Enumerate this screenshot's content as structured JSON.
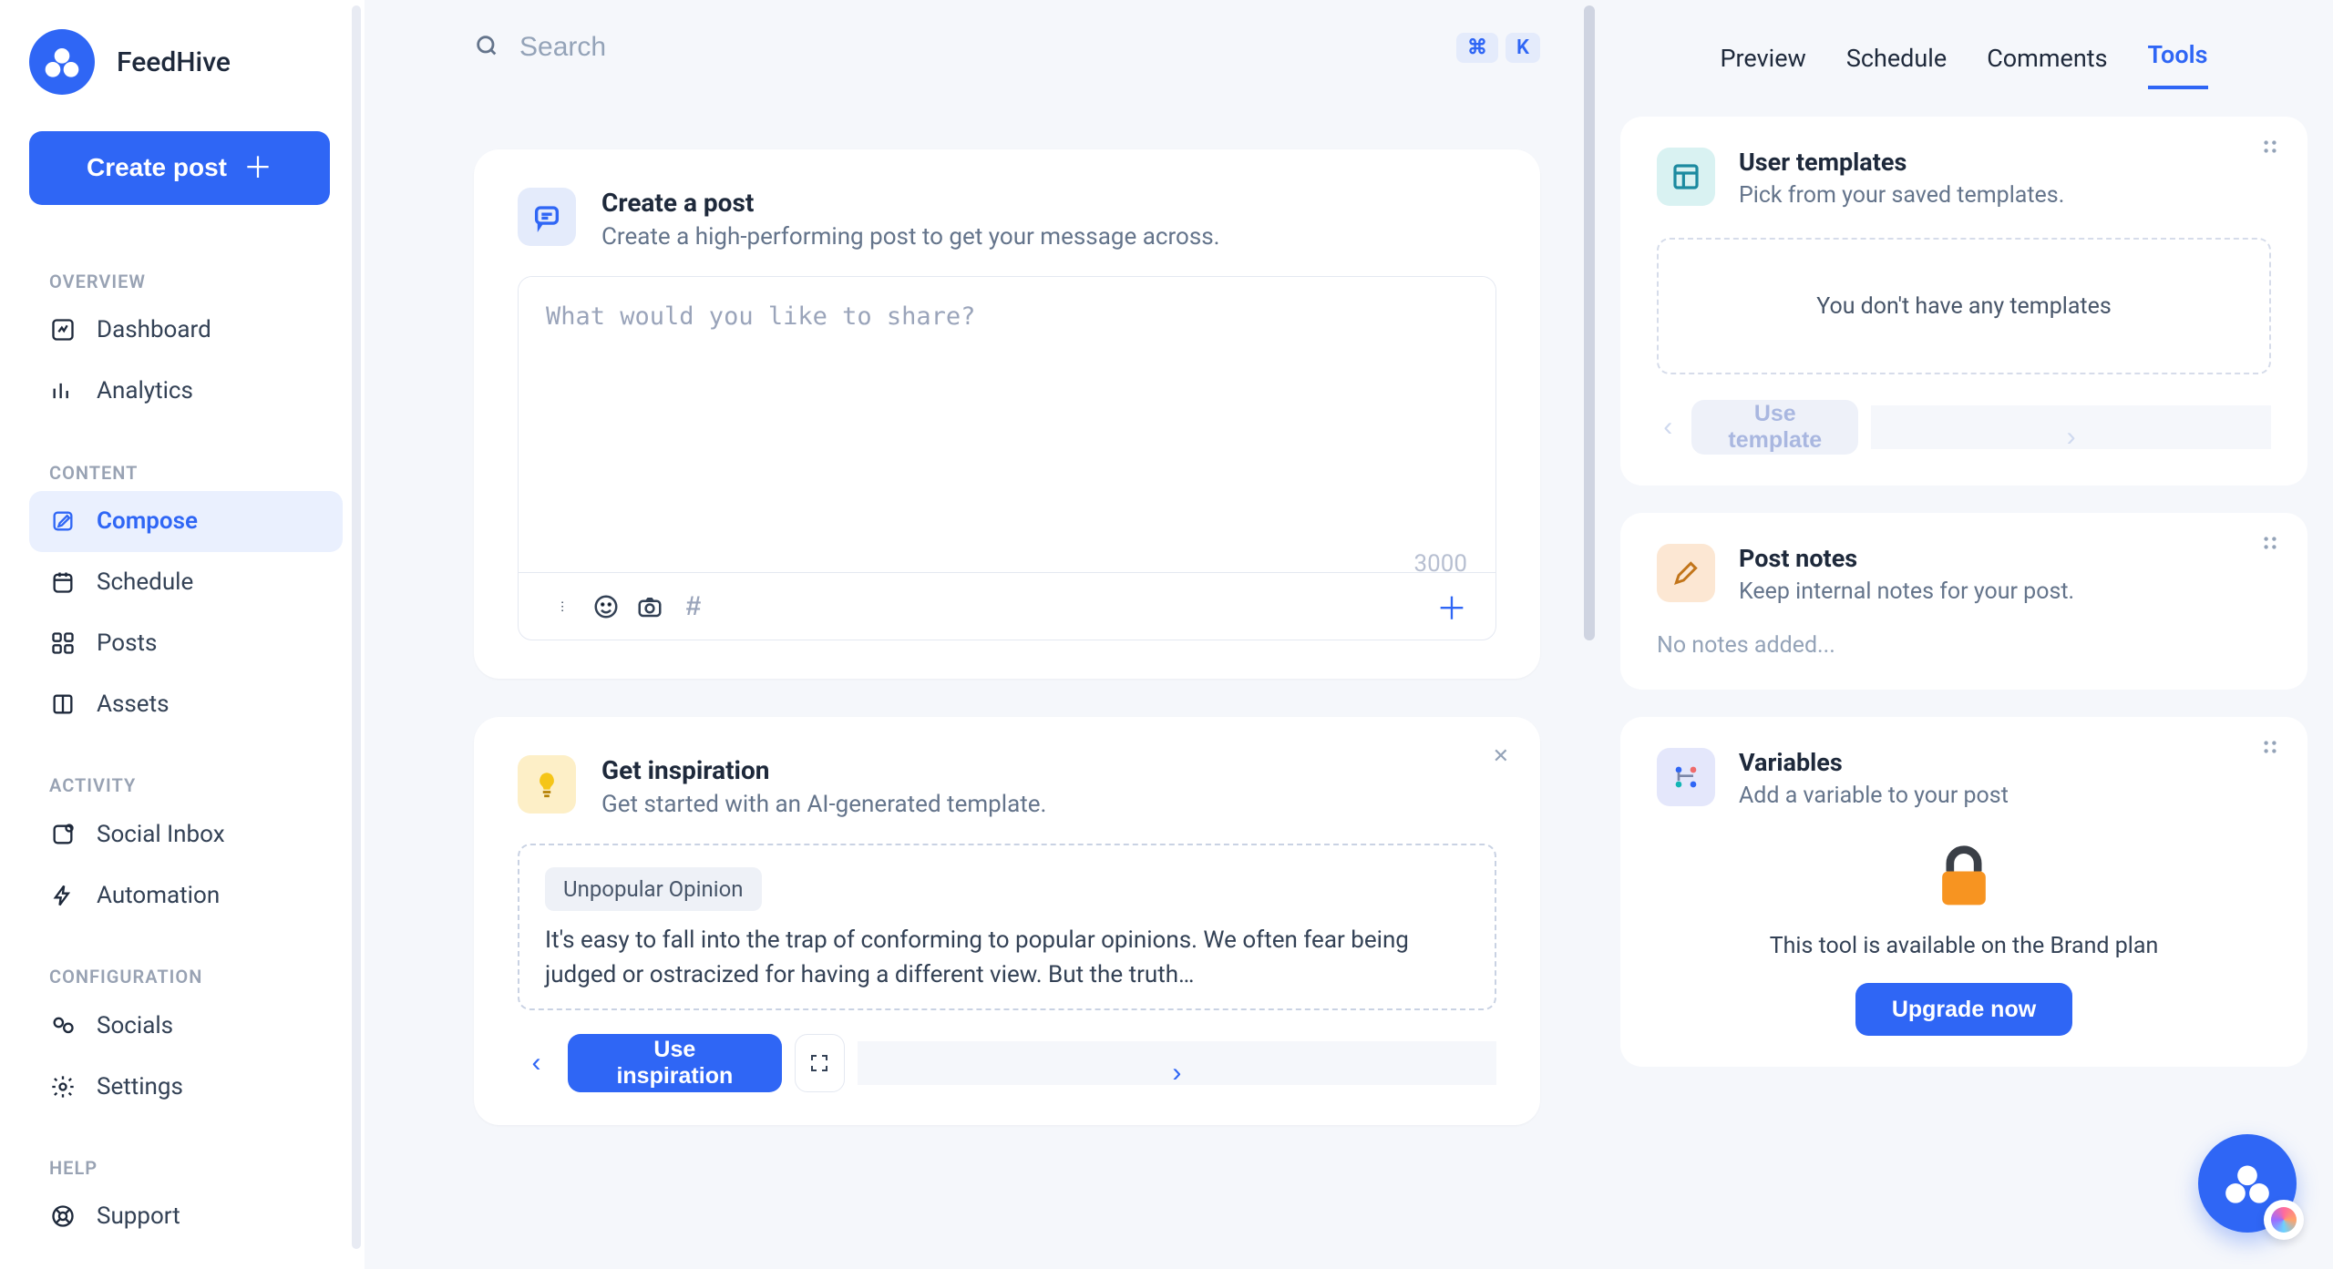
{
  "brand": {
    "name": "FeedHive"
  },
  "create_post_label": "Create post",
  "sidebar": {
    "sections": [
      {
        "label": "OVERVIEW",
        "items": [
          {
            "id": "dashboard",
            "label": "Dashboard"
          },
          {
            "id": "analytics",
            "label": "Analytics"
          }
        ]
      },
      {
        "label": "CONTENT",
        "items": [
          {
            "id": "compose",
            "label": "Compose",
            "active": true
          },
          {
            "id": "schedule",
            "label": "Schedule"
          },
          {
            "id": "posts",
            "label": "Posts"
          },
          {
            "id": "assets",
            "label": "Assets"
          }
        ]
      },
      {
        "label": "ACTIVITY",
        "items": [
          {
            "id": "social-inbox",
            "label": "Social Inbox"
          },
          {
            "id": "automation",
            "label": "Automation"
          }
        ]
      },
      {
        "label": "CONFIGURATION",
        "items": [
          {
            "id": "socials",
            "label": "Socials"
          },
          {
            "id": "settings",
            "label": "Settings"
          }
        ]
      },
      {
        "label": "HELP",
        "items": [
          {
            "id": "support",
            "label": "Support"
          }
        ]
      }
    ]
  },
  "search": {
    "placeholder": "Search",
    "kbd1": "⌘",
    "kbd2": "K"
  },
  "compose": {
    "title": "Create a post",
    "subtitle": "Create a high-performing post to get your message across.",
    "placeholder": "What would you like to share?",
    "char_limit": "3000"
  },
  "toolbar_icons": {
    "more": "more-vertical-icon",
    "emoji": "emoji-icon",
    "camera": "camera-icon",
    "hashtag": "hashtag-icon",
    "add": "plus-icon"
  },
  "inspiration": {
    "title": "Get inspiration",
    "subtitle": "Get started with an AI-generated template.",
    "tag": "Unpopular Opinion",
    "text": "It's easy to fall into the trap of conforming to popular opinions. We often fear being judged or ostracized for having a different view. But the truth…",
    "use_label": "Use inspiration"
  },
  "right_tabs": [
    "Preview",
    "Schedule",
    "Comments",
    "Tools"
  ],
  "right_active_tab": "Tools",
  "user_templates": {
    "title": "User templates",
    "subtitle": "Pick from your saved templates.",
    "empty": "You don't have any templates",
    "use_label": "Use template"
  },
  "post_notes": {
    "title": "Post notes",
    "subtitle": "Keep internal notes for your post.",
    "empty": "No notes added..."
  },
  "variables": {
    "title": "Variables",
    "subtitle": "Add a variable to your post",
    "locked_text": "This tool is available on the Brand plan",
    "upgrade_label": "Upgrade now"
  },
  "colors": {
    "accent": "#2f66f5"
  }
}
